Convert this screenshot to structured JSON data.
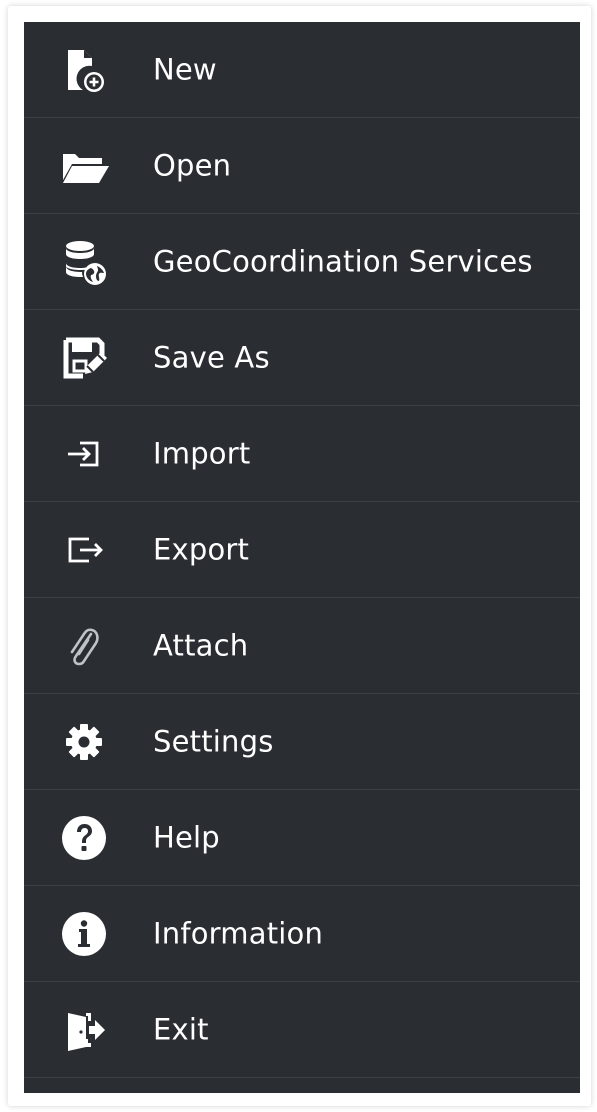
{
  "menu": {
    "items": [
      {
        "label": "New",
        "icon": "new-file-icon"
      },
      {
        "label": "Open",
        "icon": "folder-open-icon"
      },
      {
        "label": "GeoCoordination Services",
        "icon": "database-globe-icon"
      },
      {
        "label": "Save As",
        "icon": "save-as-icon"
      },
      {
        "label": "Import",
        "icon": "import-icon"
      },
      {
        "label": "Export",
        "icon": "export-icon"
      },
      {
        "label": "Attach",
        "icon": "paperclip-icon"
      },
      {
        "label": "Settings",
        "icon": "gear-icon"
      },
      {
        "label": "Help",
        "icon": "help-icon"
      },
      {
        "label": "Information",
        "icon": "info-icon"
      },
      {
        "label": "Exit",
        "icon": "exit-icon"
      }
    ]
  },
  "colors": {
    "menu_background": "#2a2e33",
    "divider": "#3b4046",
    "text": "#ffffff",
    "icon_muted": "#bfc3c7"
  }
}
